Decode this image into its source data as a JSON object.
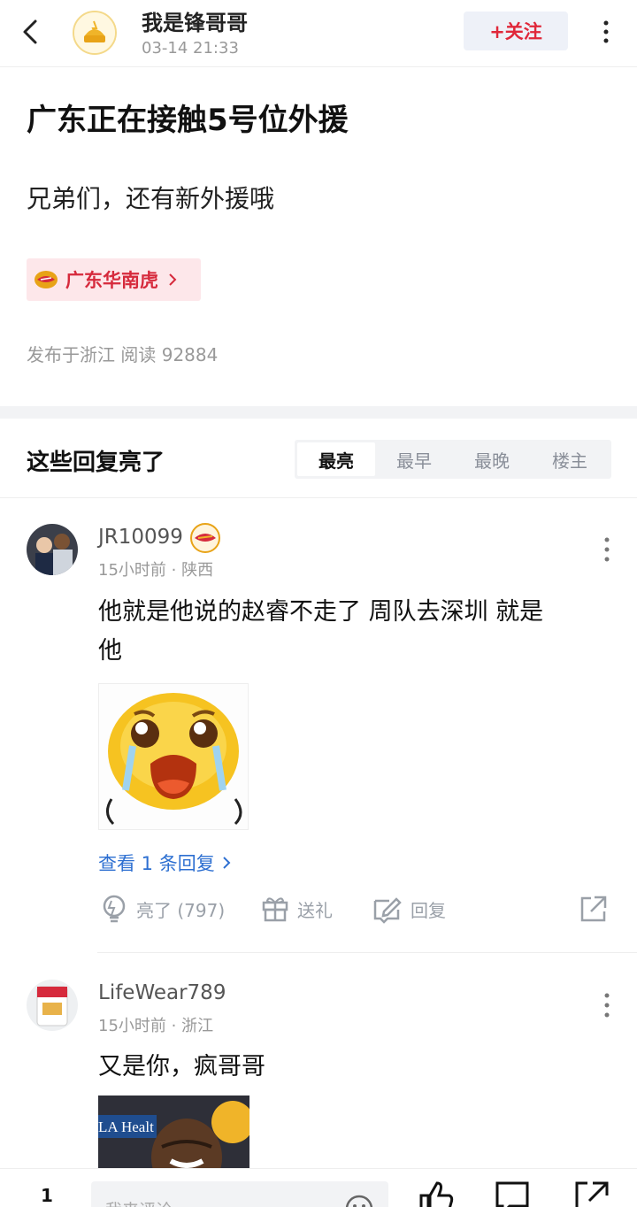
{
  "header": {
    "author": "我是锋哥哥",
    "time": "03-14 21:33",
    "follow_label": "+关注"
  },
  "post": {
    "title": "广东正在接触5号位外援",
    "body": "兄弟们，还有新外援哦",
    "tag": "广东华南虎",
    "meta": "发布于浙江  阅读 92884"
  },
  "comments_section": {
    "title": "这些回复亮了",
    "sort_options": [
      "最亮",
      "最早",
      "最晚",
      "楼主"
    ],
    "selected_sort": "最亮"
  },
  "comments": [
    {
      "user": "JR10099",
      "time_location": "15小时前 · 陕西",
      "text_line1": "他就是他说的赵睿不走了 周队去深圳 就是",
      "text_line2": "他",
      "view_replies": "查看 1 条回复",
      "like_label": "亮了 (797)",
      "gift_label": "送礼",
      "reply_label": "回复"
    },
    {
      "user": "LifeWear789",
      "time_location": "15小时前 · 浙江",
      "text_line1": "又是你，疯哥哥",
      "image_text": "LA Healt"
    }
  ],
  "bottom_bar": {
    "count": "1",
    "input_placeholder": "我来评论"
  },
  "icons": {
    "back": "chevron-left-icon",
    "more": "more-vertical-icon",
    "team_logo": "team-logo-icon",
    "like": "lightbulb-icon",
    "gift": "gift-icon",
    "reply": "edit-icon",
    "share": "share-icon",
    "emoji": "smiley-icon",
    "thumb": "thumbs-up-icon",
    "comment": "comment-icon"
  },
  "colors": {
    "accent_red": "#d62a3c",
    "link_blue": "#2d6fd1",
    "tag_bg": "#fde7ea"
  }
}
